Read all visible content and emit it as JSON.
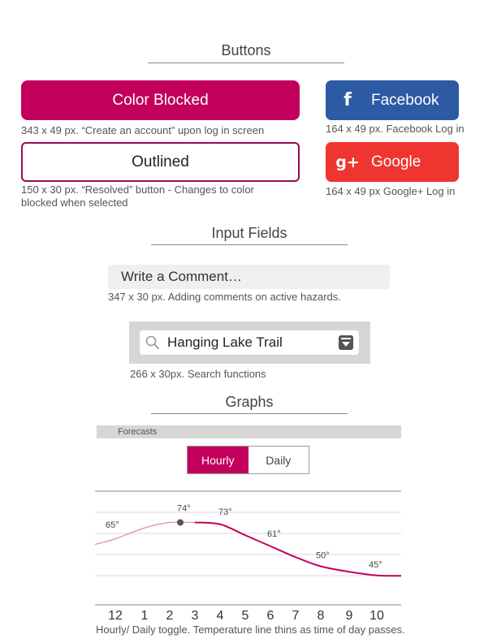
{
  "buttons_section": {
    "title": "Buttons",
    "color_blocked": {
      "label": "Color Blocked",
      "caption": "343 x 49 px. “Create an account” upon log in screen"
    },
    "outlined": {
      "label": "Outlined",
      "caption": "150 x 30 px. “Resolved” button - Changes to color blocked when selected"
    },
    "facebook": {
      "icon": "f",
      "label": "Facebook",
      "caption": "164 x 49 px. Facebook Log in"
    },
    "google": {
      "icon": "g+",
      "label": "Google",
      "caption": "164 x 49 px Google+ Log in"
    },
    "colors": {
      "accent": "#c2005b",
      "facebook": "#2c5aa3",
      "google": "#ef3530"
    }
  },
  "inputs_section": {
    "title": "Input Fields",
    "comment": {
      "value": "Write a Comment…",
      "caption": "347 x 30 px. Adding comments on active hazards."
    },
    "search": {
      "value": "Hanging Lake Trail",
      "caption": "266 x 30px. Search functions",
      "icons": [
        "search-icon",
        "dropdown-icon"
      ]
    }
  },
  "graphs_section": {
    "title": "Graphs",
    "forecast_bar": "Forecasts",
    "toggle": {
      "hourly": "Hourly",
      "daily": "Daily",
      "active": "hourly"
    },
    "caption": "Hourly/ Daily toggle. Temperature line thins as time of day passes."
  },
  "chart_data": {
    "type": "line",
    "x": [
      "12",
      "1",
      "2",
      "3",
      "4",
      "5",
      "6",
      "7",
      "8",
      "9",
      "10"
    ],
    "labels": [
      {
        "x": "12",
        "text": "65°"
      },
      {
        "x": "3",
        "text": "74°"
      },
      {
        "x": "4",
        "text": "73°"
      },
      {
        "x": "6",
        "text": "61°"
      },
      {
        "x": "8",
        "text": "50°"
      },
      {
        "x": "10",
        "text": "45°"
      }
    ],
    "series": [
      {
        "values": [
          65,
          71,
          74,
          74,
          73,
          67,
          61,
          55,
          50,
          47,
          45
        ]
      }
    ],
    "current_point": "3",
    "ylim": [
      40,
      80
    ],
    "grid": true,
    "line_color": "#c2005b"
  }
}
